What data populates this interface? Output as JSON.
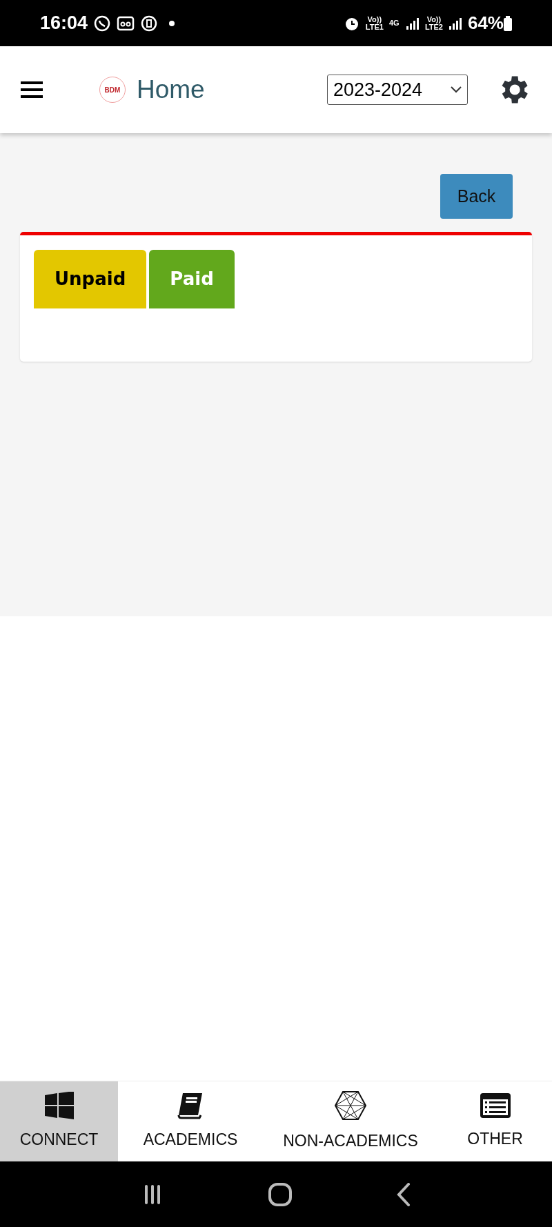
{
  "status_bar": {
    "time": "16:04",
    "sim1": [
      "Vo))",
      "LTE1"
    ],
    "network": "4G",
    "sim2": [
      "Vo))",
      "LTE2"
    ],
    "battery": "64%"
  },
  "header": {
    "title": "Home",
    "logo": "BDM",
    "year_select": {
      "value": "2023-2024"
    }
  },
  "back_button": "Back",
  "tabs": [
    {
      "label": "Unpaid",
      "color": "#e3c700"
    },
    {
      "label": "Paid",
      "color": "#62a81c"
    }
  ],
  "bottom_nav": [
    {
      "label": "CONNECT",
      "kind": "windows",
      "selected": true
    },
    {
      "label": "ACADEMICS",
      "kind": "book",
      "selected": false
    },
    {
      "label": "NON-ACADEMICS",
      "kind": "hexagon",
      "selected": false
    },
    {
      "label": "OTHER",
      "kind": "list",
      "selected": false
    }
  ]
}
